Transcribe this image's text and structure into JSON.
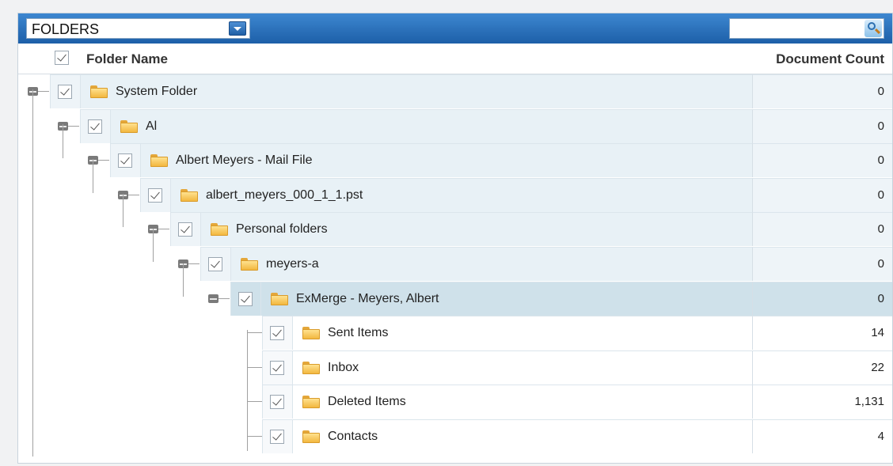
{
  "toolbar": {
    "view_select": "FOLDERS",
    "search_placeholder": ""
  },
  "header": {
    "folder_name": "Folder Name",
    "document_count": "Document Count"
  },
  "rows": [
    {
      "name": "System Folder",
      "count": "0",
      "depth": 0,
      "expanded": true,
      "selected": false
    },
    {
      "name": "Al",
      "count": "0",
      "depth": 1,
      "expanded": true,
      "selected": false
    },
    {
      "name": "Albert Meyers - Mail File",
      "count": "0",
      "depth": 2,
      "expanded": true,
      "selected": false
    },
    {
      "name": "albert_meyers_000_1_1.pst",
      "count": "0",
      "depth": 3,
      "expanded": true,
      "selected": false
    },
    {
      "name": "Personal folders",
      "count": "0",
      "depth": 4,
      "expanded": true,
      "selected": false
    },
    {
      "name": "meyers-a",
      "count": "0",
      "depth": 5,
      "expanded": true,
      "selected": false
    },
    {
      "name": "ExMerge - Meyers, Albert",
      "count": "0",
      "depth": 6,
      "expanded": true,
      "selected": true
    },
    {
      "name": "Sent Items",
      "count": "14",
      "depth": 7,
      "expanded": false,
      "selected": false
    },
    {
      "name": "Inbox",
      "count": "22",
      "depth": 7,
      "expanded": false,
      "selected": false
    },
    {
      "name": "Deleted Items",
      "count": "1,131",
      "depth": 7,
      "expanded": false,
      "selected": false
    },
    {
      "name": "Contacts",
      "count": "4",
      "depth": 7,
      "expanded": false,
      "selected": false
    }
  ],
  "icons": {
    "dropdown": "chevron-down-icon",
    "search": "search-icon",
    "folder": "folder-icon",
    "toggle": "collapse-icon",
    "checkbox": "checkbox-checked-icon"
  },
  "colors": {
    "toolbar": "#2a6fbc",
    "row_bg": "#e8f1f6",
    "selected_row_bg": "#cfe1ea"
  }
}
